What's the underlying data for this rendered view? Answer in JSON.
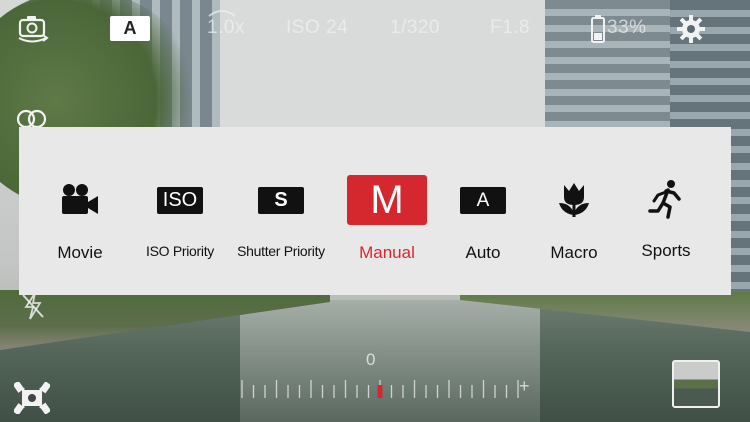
{
  "topbar": {
    "camera_switch_icon": "camera-switch-icon",
    "mode_badge": "A",
    "zoom": "1.0x",
    "iso": "ISO 24",
    "shutter": "1/320",
    "aperture": "F1.8",
    "battery": "33%",
    "settings_icon": "gear-icon"
  },
  "side": {
    "filter_icon": "overlap-circles-icon",
    "flash_icon": "flash-off-icon",
    "focus_icon": "focus-frame-icon"
  },
  "modes": [
    {
      "label": "Movie",
      "icon": "movie-camera-icon",
      "active": false
    },
    {
      "label": "ISO Priority",
      "icon": "iso-icon",
      "icon_text": "ISO",
      "active": false
    },
    {
      "label": "Shutter Priority",
      "icon": "s-icon",
      "icon_text": "S",
      "active": false
    },
    {
      "label": "Manual",
      "icon": "m-icon",
      "icon_text": "M",
      "active": true
    },
    {
      "label": "Auto",
      "icon": "a-icon",
      "icon_text": "A",
      "active": false
    },
    {
      "label": "Macro",
      "icon": "flower-icon",
      "active": false
    },
    {
      "label": "Sports",
      "icon": "running-person-icon",
      "active": false
    }
  ],
  "exposure": {
    "zero_label": "0",
    "plus_label": "+",
    "value": 0
  },
  "colors": {
    "accent": "#d5282e",
    "panel": "#e8e8e8",
    "icon": "#111111"
  }
}
